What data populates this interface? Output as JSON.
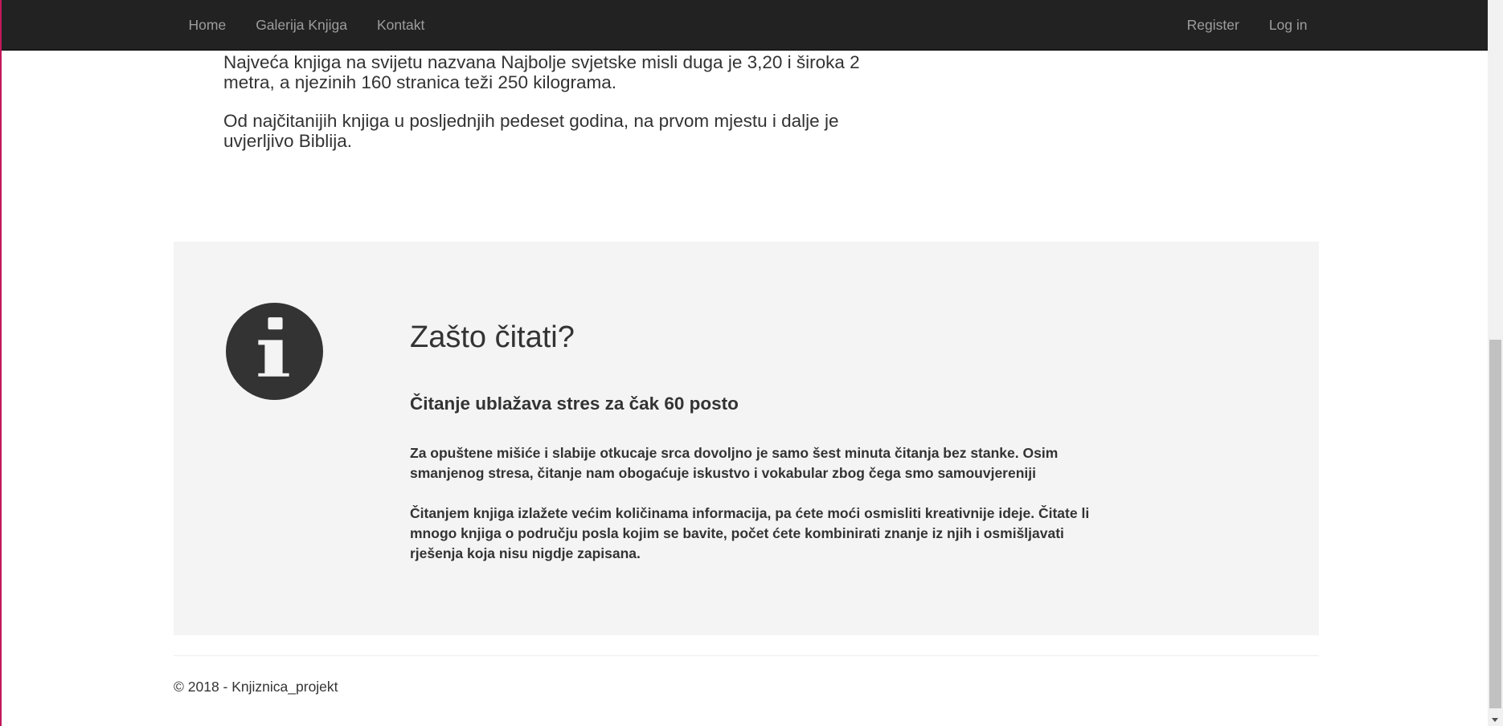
{
  "navbar": {
    "left_items": [
      {
        "label": "Home"
      },
      {
        "label": "Galerija Knjiga"
      },
      {
        "label": "Kontakt"
      }
    ],
    "right_items": [
      {
        "label": "Register"
      },
      {
        "label": "Log in"
      }
    ]
  },
  "intro": {
    "paragraph_1": "Najveća knjiga na svijetu nazvana Najbolje svjetske misli duga je 3,20 i široka 2 metra, a njezinih 160 stranica teži 250 kilograma.",
    "paragraph_2": "Od najčitanijih knjiga u posljednjih pedeset godina, na prvom mjestu i dalje je uvjerljivo Biblija."
  },
  "jumbotron": {
    "icon": "info-icon",
    "title": "Zašto čitati?",
    "subtitle": "Čitanje ublažava stres za čak 60 posto",
    "paragraph_1": "Za opuštene mišiće i slabije otkucaje srca dovoljno je samo šest minuta čitanja bez stanke. Osim smanjenog stresa, čitanje nam obogaćuje iskustvo i vokabular zbog čega smo samouvjereniji",
    "paragraph_2": "Čitanjem knjiga izlažete većim količinama informacija, pa ćete moći osmisliti kreativnije ideje. Čitate li mnogo knjiga o području posla kojim se bavite, počet ćete kombinirati znanje iz njih i osmišljavati rješenja koja nisu nigdje zapisana."
  },
  "footer": {
    "copyright": "© 2018 - Knjiznica_projekt"
  },
  "colors": {
    "navbar_bg": "#222222",
    "nav_link": "#9d9d9d",
    "jumbotron_bg": "#f4f4f4",
    "text": "#333333",
    "left_accent": "#c2185b"
  }
}
